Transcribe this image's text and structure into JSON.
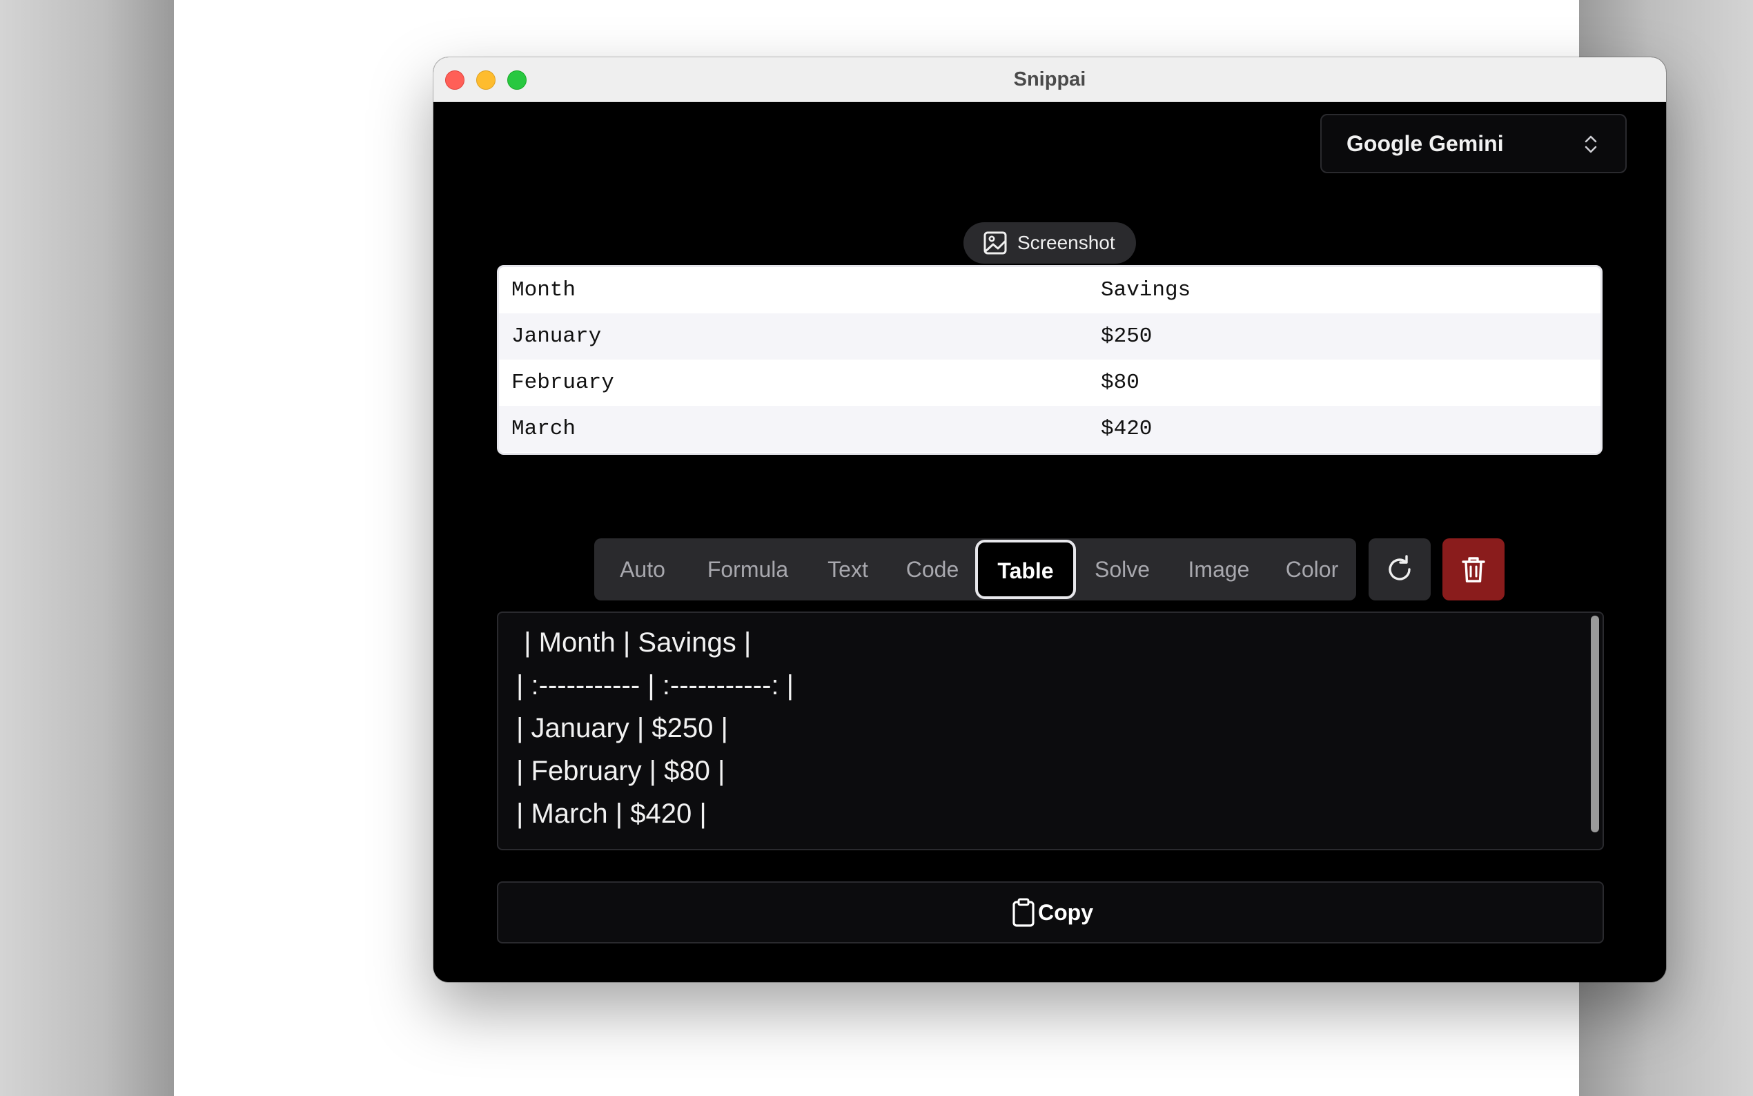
{
  "window": {
    "title": "Snippai"
  },
  "model_select": {
    "value": "Google Gemini"
  },
  "capture": {
    "label": "Screenshot"
  },
  "preview_table": {
    "rows": [
      [
        "Month",
        "Savings"
      ],
      [
        "January",
        "$250"
      ],
      [
        "February",
        "$80"
      ],
      [
        "March",
        "$420"
      ]
    ]
  },
  "modes": [
    "Auto",
    "Formula",
    "Text",
    "Code",
    "Table",
    "Solve",
    "Image",
    "Color"
  ],
  "active_mode": "Table",
  "output": {
    "lines": [
      " | Month | Savings |",
      "| :----------- | :-----------: |",
      "| January | $250 |",
      "| February | $80 |",
      "| March | $420 |"
    ]
  },
  "copy": {
    "label": "Copy"
  },
  "colors": {
    "background": "#000000",
    "panel": "#2a2a2d",
    "delete": "#8a1c1c",
    "text": "#f2f2f2",
    "muted": "#a8a8ae"
  },
  "icons": {
    "model_chevron": "chevron-up-down-icon",
    "capture": "image-icon",
    "refresh": "refresh-icon",
    "delete": "trash-icon",
    "copy": "clipboard-icon"
  }
}
